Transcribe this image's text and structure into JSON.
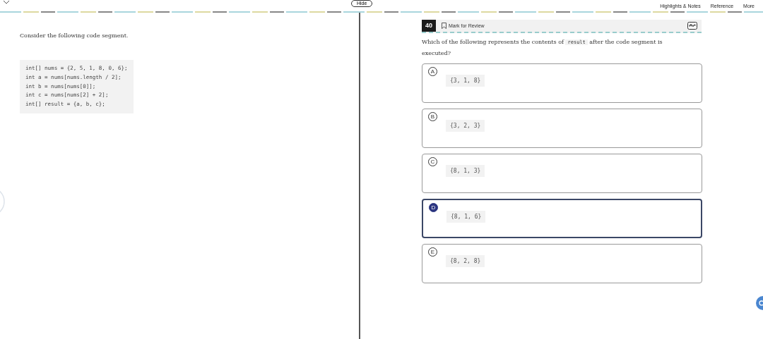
{
  "top_bar": {
    "hide_button": "Hide",
    "menu": [
      "Highlights & Notes",
      "Reference",
      "More"
    ]
  },
  "passage": {
    "intro": "Consider the following code segment.",
    "code": [
      "int[] nums = {2, 5, 1, 8, 0, 6};",
      "int a = nums[nums.length / 2];",
      "int b = nums[nums[0]];",
      "int c = nums[nums[2] + 2];",
      "int[] result = {a, b, c};"
    ]
  },
  "question": {
    "number": "40",
    "mark_for_review": "Mark for Review",
    "marked": false,
    "prompt_before": "Which of the following represents the contents of",
    "prompt_code": "result",
    "prompt_after": "after the code segment is executed?",
    "choices": [
      {
        "letter": "A",
        "text": "{3, 1, 8}",
        "selected": false
      },
      {
        "letter": "B",
        "text": "{3, 2, 3}",
        "selected": false
      },
      {
        "letter": "C",
        "text": "{8, 1, 3}",
        "selected": false
      },
      {
        "letter": "D",
        "text": "{8, 1, 6}",
        "selected": true
      },
      {
        "letter": "E",
        "text": "{8, 2, 8}",
        "selected": false
      }
    ]
  }
}
